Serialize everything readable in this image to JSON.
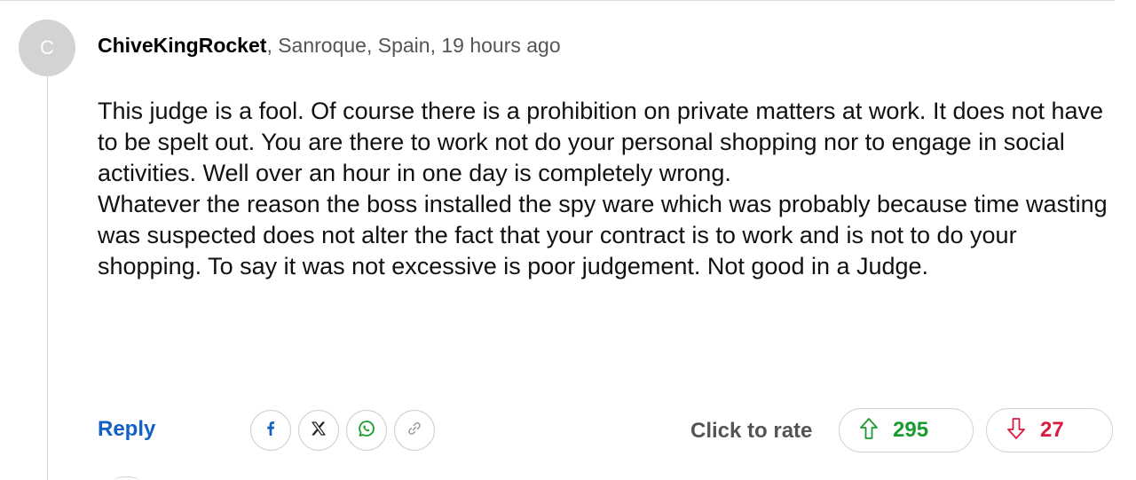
{
  "comment": {
    "avatar_initial": "C",
    "username": "ChiveKingRocket",
    "location_time": ", Sanroque, Spain, 19 hours ago",
    "paragraphs": [
      "This judge is a fool. Of course there is a prohibition on private matters at work. It does not have to be spelt out. You are there to work not do your personal shopping nor to engage in social activities. Well over an hour in one day is completely wrong.",
      "Whatever the reason the boss installed the spy ware which was probably because time wasting was suspected does not alter the fact that your contract is to work and is not to do your shopping. To say it was not excessive is poor judgement. Not good in a Judge."
    ]
  },
  "actions": {
    "reply_label": "Reply",
    "share_icons": [
      "facebook-icon",
      "x-icon",
      "whatsapp-icon",
      "link-icon"
    ],
    "rate_label": "Click to rate",
    "upvotes": "295",
    "downvotes": "27"
  },
  "colors": {
    "reply": "#1261c4",
    "upvote": "#1a9b2f",
    "downvote": "#d81b3f",
    "avatar_bg": "#d3d3d3"
  }
}
